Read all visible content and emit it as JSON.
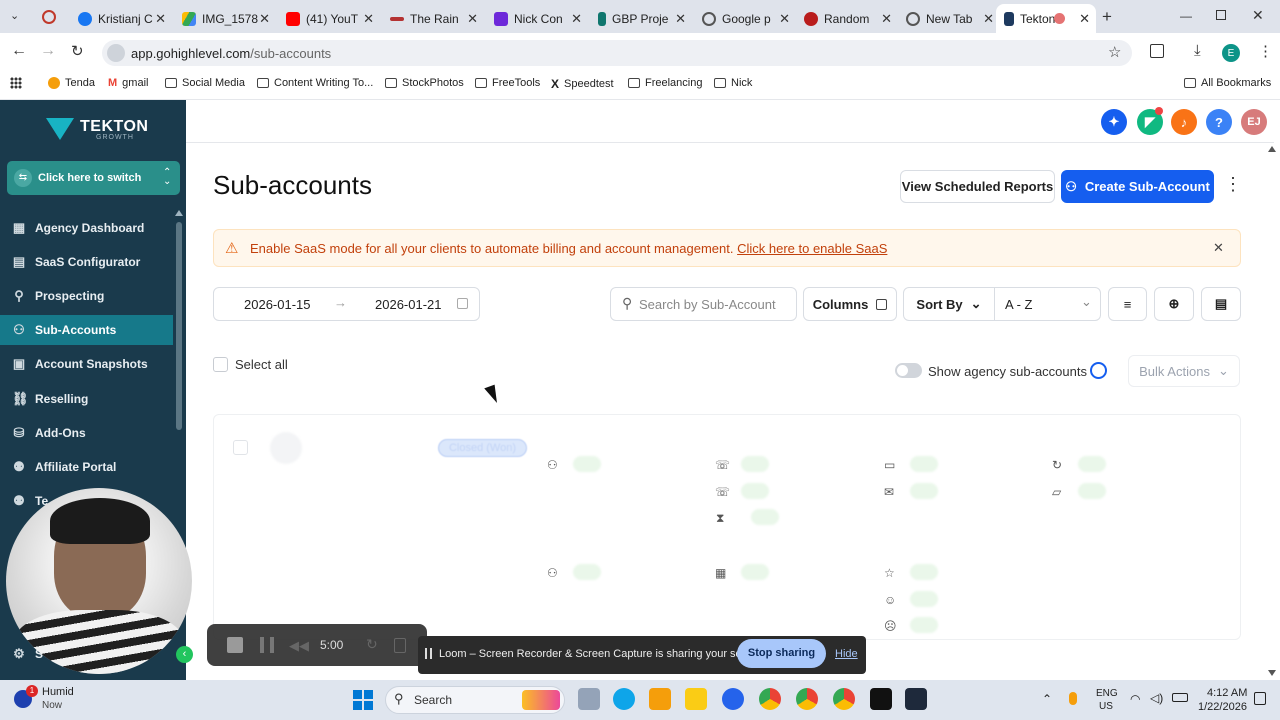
{
  "browser": {
    "tabs": [
      {
        "label": "Kristianj C",
        "color": "#1877f2"
      },
      {
        "label": "IMG_1578",
        "color": "#34a853"
      },
      {
        "label": "(41) YouT",
        "color": "#ff0000"
      },
      {
        "label": "The Rain",
        "color": "#b43232"
      },
      {
        "label": "Nick Con",
        "color": "#6d28d9"
      },
      {
        "label": "GBP Proje",
        "color": "#0f766e"
      },
      {
        "label": "Google p",
        "color": "#555555"
      },
      {
        "label": "Random",
        "color": "#b91c1c"
      },
      {
        "label": "New Tab",
        "color": "#555555"
      },
      {
        "label": "Tekton",
        "color": "#1e3a5f"
      }
    ],
    "url_host": "app.gohighlevel.com",
    "url_path": "/sub-accounts",
    "profile_initial": "E",
    "bookmarks": [
      "Tenda",
      "gmail",
      "Social Media",
      "Content Writing To...",
      "StockPhotos",
      "FreeTools",
      "Speedtest",
      "Freelancing",
      "Nick"
    ],
    "all_bookmarks": "All Bookmarks"
  },
  "sidebar": {
    "logo_text": "TEKTON",
    "logo_sub": "GROWTH",
    "switcher_label": "Click here to switch",
    "items": [
      {
        "label": "Agency Dashboard",
        "icon": "dashboard-icon"
      },
      {
        "label": "SaaS Configurator",
        "icon": "chart-icon"
      },
      {
        "label": "Prospecting",
        "icon": "user-search-icon"
      },
      {
        "label": "Sub-Accounts",
        "icon": "user-icon"
      },
      {
        "label": "Account Snapshots",
        "icon": "snapshot-icon"
      },
      {
        "label": "Reselling",
        "icon": "reselling-icon"
      },
      {
        "label": "Add-Ons",
        "icon": "bag-icon"
      },
      {
        "label": "Affiliate Portal",
        "icon": "users-icon"
      },
      {
        "label": "Te",
        "icon": "team-icon"
      },
      {
        "label": "S",
        "icon": "settings-icon"
      }
    ]
  },
  "header": {
    "avatar_initials": "EJ",
    "help": "?"
  },
  "page": {
    "title": "Sub-accounts",
    "view_reports": "View Scheduled Reports",
    "create_btn": "Create Sub-Account",
    "banner_text": "Enable SaaS mode for all your clients to automate billing and account management.",
    "banner_link": "Click here to enable SaaS",
    "date_from": "2026-01-15",
    "date_to": "2026-01-21",
    "search_placeholder": "Search by Sub-Account",
    "columns_label": "Columns",
    "sort_by_label": "Sort By",
    "sort_value": "A - Z",
    "select_all": "Select all",
    "show_agency": "Show agency sub-accounts",
    "bulk_actions": "Bulk Actions",
    "skeleton_badge": "Closed (Won)"
  },
  "loom": {
    "timer": "5:00",
    "message": "Loom – Screen Recorder & Screen Capture is sharing your screen.",
    "stop": "Stop sharing",
    "hide": "Hide"
  },
  "taskbar": {
    "weather": "Humid",
    "weather_sub": "Now",
    "badge": "1",
    "search": "Search",
    "lang": "ENG",
    "region": "US",
    "time": "4:12 AM",
    "date": "1/22/2026"
  },
  "colors": {
    "sidebar": "#1a3a4c",
    "active_nav": "#16798a",
    "primary": "#155eef",
    "warning": "#c2410c"
  }
}
